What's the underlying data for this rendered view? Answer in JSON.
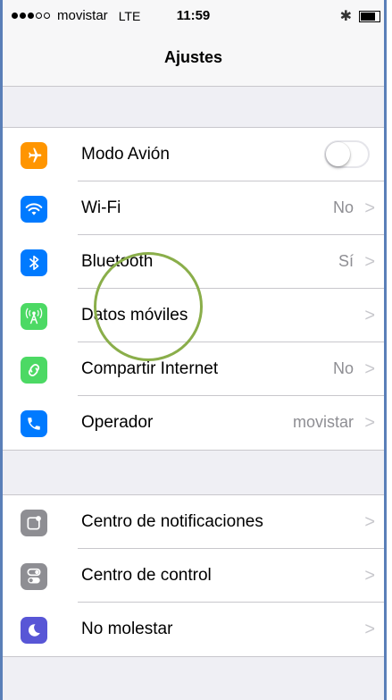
{
  "status_bar": {
    "carrier": "movistar",
    "network": "LTE",
    "time": "11:59",
    "signal_bars_filled": 3,
    "signal_bars_total": 5
  },
  "nav": {
    "title": "Ajustes"
  },
  "group1": [
    {
      "label": "Modo Avión",
      "icon": "airplane-icon",
      "color": "#ff9500",
      "toggle": false
    },
    {
      "label": "Wi-Fi",
      "icon": "wifi-icon",
      "color": "#007aff",
      "value": "No"
    },
    {
      "label": "Bluetooth",
      "icon": "bluetooth-icon",
      "color": "#007aff",
      "value": "Sí"
    },
    {
      "label": "Datos móviles",
      "icon": "antenna-icon",
      "color": "#4cd964",
      "value": ""
    },
    {
      "label": "Compartir Internet",
      "icon": "link-icon",
      "color": "#4cd964",
      "value": "No"
    },
    {
      "label": "Operador",
      "icon": "phone-icon",
      "color": "#007aff",
      "value": "movistar"
    }
  ],
  "group2": [
    {
      "label": "Centro de notificaciones",
      "icon": "notifications-icon",
      "color": "#8e8e93"
    },
    {
      "label": "Centro de control",
      "icon": "control-center-icon",
      "color": "#8e8e93"
    },
    {
      "label": "No molestar",
      "icon": "moon-icon",
      "color": "#5856d6"
    }
  ],
  "chevron": ">"
}
